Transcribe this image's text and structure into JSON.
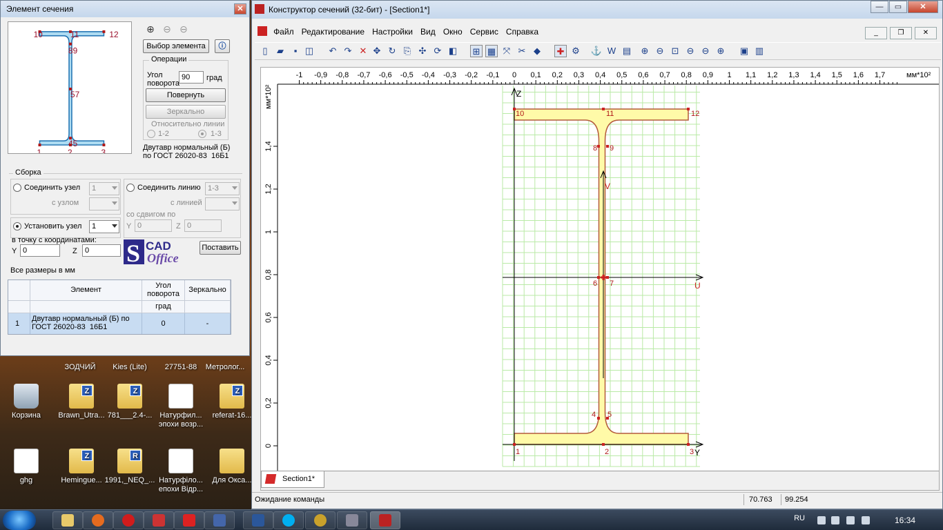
{
  "desktop": {
    "icons": [
      {
        "label": "Корзина",
        "type": "trash"
      },
      {
        "label": "Brawn_Utra...",
        "type": "folder",
        "badge": "Z"
      },
      {
        "label": "781___2.4-...",
        "type": "folder",
        "badge": "Z"
      },
      {
        "label": "Натурфил...\nэпохи возр...",
        "type": "doc"
      },
      {
        "label": "referat-16...",
        "type": "folder",
        "badge": "Z"
      },
      {
        "label": "ghg",
        "type": "doc"
      },
      {
        "label": "Hemingue...",
        "type": "folder",
        "badge": "Z"
      },
      {
        "label": "1991,_NEQ_...",
        "type": "folder",
        "badge": "R"
      },
      {
        "label": "Натурфіло...\nепохи Відр...",
        "type": "doc"
      },
      {
        "label": "Для Окса...",
        "type": "folder",
        "badge": ""
      }
    ],
    "top_row_labels": [
      "ЗОДЧИЙ",
      "Kies (Lite)",
      "27751-88",
      "Метролог..."
    ]
  },
  "taskbar": {
    "lang": "RU",
    "clock": "16:34"
  },
  "main_window": {
    "title": "Конструктор сечений (32-бит) - [Section1*]",
    "menu": [
      "Файл",
      "Редактирование",
      "Настройки",
      "Вид",
      "Окно",
      "Сервис",
      "Справка"
    ],
    "toolbar_icons": [
      "new-icon",
      "open-icon",
      "save-icon",
      "props-icon",
      "undo-icon",
      "redo-icon",
      "delete-icon",
      "move-icon",
      "rotate-icon",
      "copy-icon",
      "pan-icon",
      "refresh-icon",
      "mirror-icon",
      "snap-icon",
      "grid-icon",
      "dim-icon",
      "cut-icon",
      "point-icon",
      "cross-icon",
      "calc-icon",
      "hook-icon",
      "w-icon",
      "color-icon",
      "zoom-in-icon",
      "zoom-out-icon",
      "zoom-box-icon",
      "zoom-prev-icon",
      "zoom-all-icon",
      "zoom-fit-icon",
      "print-icon",
      "export-icon"
    ],
    "tab": "Section1*",
    "status": {
      "text": "Ожидание команды",
      "x": "70.763",
      "y": "99.254"
    },
    "ruler": {
      "x_ticks": [
        "-1",
        "-0,9",
        "-0,8",
        "-0,7",
        "-0,6",
        "-0,5",
        "-0,4",
        "-0,3",
        "-0,2",
        "-0,1",
        "0",
        "0,1",
        "0,2",
        "0,3",
        "0,4",
        "0,5",
        "0,6",
        "0,7",
        "0,8",
        "0,9",
        "1",
        "1,1",
        "1,2",
        "1,3",
        "1,4",
        "1,5",
        "1,6",
        "1,7"
      ],
      "x_unit": "мм*10²",
      "y_unit": "мм*10²",
      "y_ticks": [
        "1,4",
        "1,2",
        "1",
        "0,8",
        "0,6",
        "0,4",
        "0,2",
        "0"
      ]
    },
    "drawing": {
      "node_labels": [
        "1",
        "2",
        "3",
        "4",
        "5",
        "6",
        "7",
        "8",
        "9",
        "10",
        "11",
        "12"
      ],
      "axis_labels": {
        "z": "Z",
        "y": "Y",
        "u": "U",
        "v": "V"
      }
    }
  },
  "left_panel": {
    "title": "Элемент сечения",
    "preview_labels": [
      "10",
      "11",
      "12",
      "89",
      "57",
      "45",
      "1",
      "2",
      "3"
    ],
    "select_element": "Выбор элемента",
    "operations": {
      "legend": "Операции",
      "angle_label": "Угол\nповорота",
      "angle_value": "90",
      "angle_unit": "град",
      "rotate": "Повернуть",
      "mirror": "Зеркально",
      "relative": "Относительно линии",
      "opt1": "1-2",
      "opt2": "1-3"
    },
    "element_desc": "Двутавр нормальный (Б)\nпо ГОСТ 26020-83  16Б1",
    "assembly": {
      "legend": "Сборка",
      "join_node": "Соединить узел",
      "join_node_val": "1",
      "with_node": "с узлом",
      "join_line": "Соединить линию",
      "join_line_val": "1-3",
      "with_line": "с линией",
      "shift": "со сдвигом по",
      "shift_y_label": "Y",
      "shift_y": "0",
      "shift_z_label": "Z",
      "shift_z": "0",
      "set_node": "Установить узел",
      "set_node_val": "1",
      "to_point": "в точку с координатами:",
      "y_label": "Y",
      "y_val": "0",
      "z_label": "Z",
      "z_val": "0",
      "place": "Поставить"
    },
    "logo_text": {
      "a": "CAD",
      "b": "Office",
      "s": "S"
    },
    "units_note": "Все размеры в мм",
    "table": {
      "headers": [
        "Элемент",
        "Угол\nповорота",
        "Зеркально"
      ],
      "sub": [
        "",
        "град",
        ""
      ],
      "rows": [
        {
          "n": "1",
          "element": "Двутавр нормальный (Б) по\nГОСТ 26020-83  16Б1",
          "angle": "0",
          "mirror": "-"
        }
      ]
    }
  }
}
